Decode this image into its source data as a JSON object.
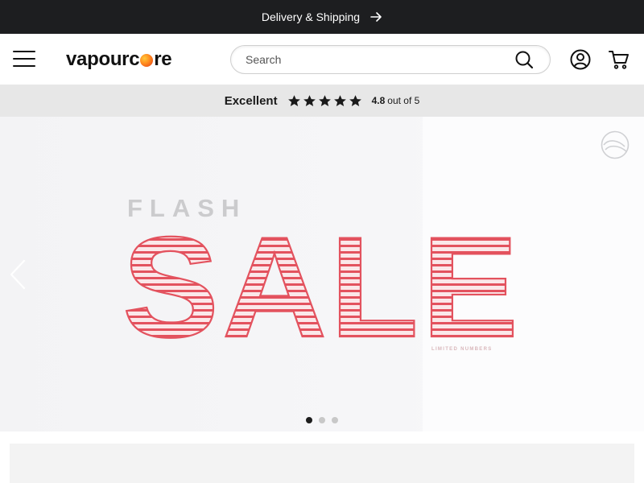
{
  "topbar": {
    "text": "Delivery & Shipping",
    "icon": "arrow-right-icon"
  },
  "header": {
    "menu_icon": "hamburger-menu-icon",
    "logo": {
      "text_before": "vapourc",
      "text_after": "re"
    },
    "search": {
      "placeholder": "Search",
      "value": "",
      "icon": "search-icon"
    },
    "account_icon": "account-icon",
    "cart_icon": "cart-icon"
  },
  "rating": {
    "label": "Excellent",
    "stars": 5,
    "score": "4.8",
    "out_of": "out of 5"
  },
  "hero": {
    "slides_total": 3,
    "active_slide": 1,
    "flash_text": "FLASH",
    "sale_text": "SALE",
    "subtext": "LIMITED NUMBERS",
    "prev_icon": "chevron-left-icon",
    "brand_icon": "brand-mark-icon",
    "colors": {
      "sale": "#e3525e",
      "flash": "#cbcbcd"
    }
  },
  "colors": {
    "topbar_bg": "#1d1e20",
    "rating_bg": "#e7e7e7"
  }
}
